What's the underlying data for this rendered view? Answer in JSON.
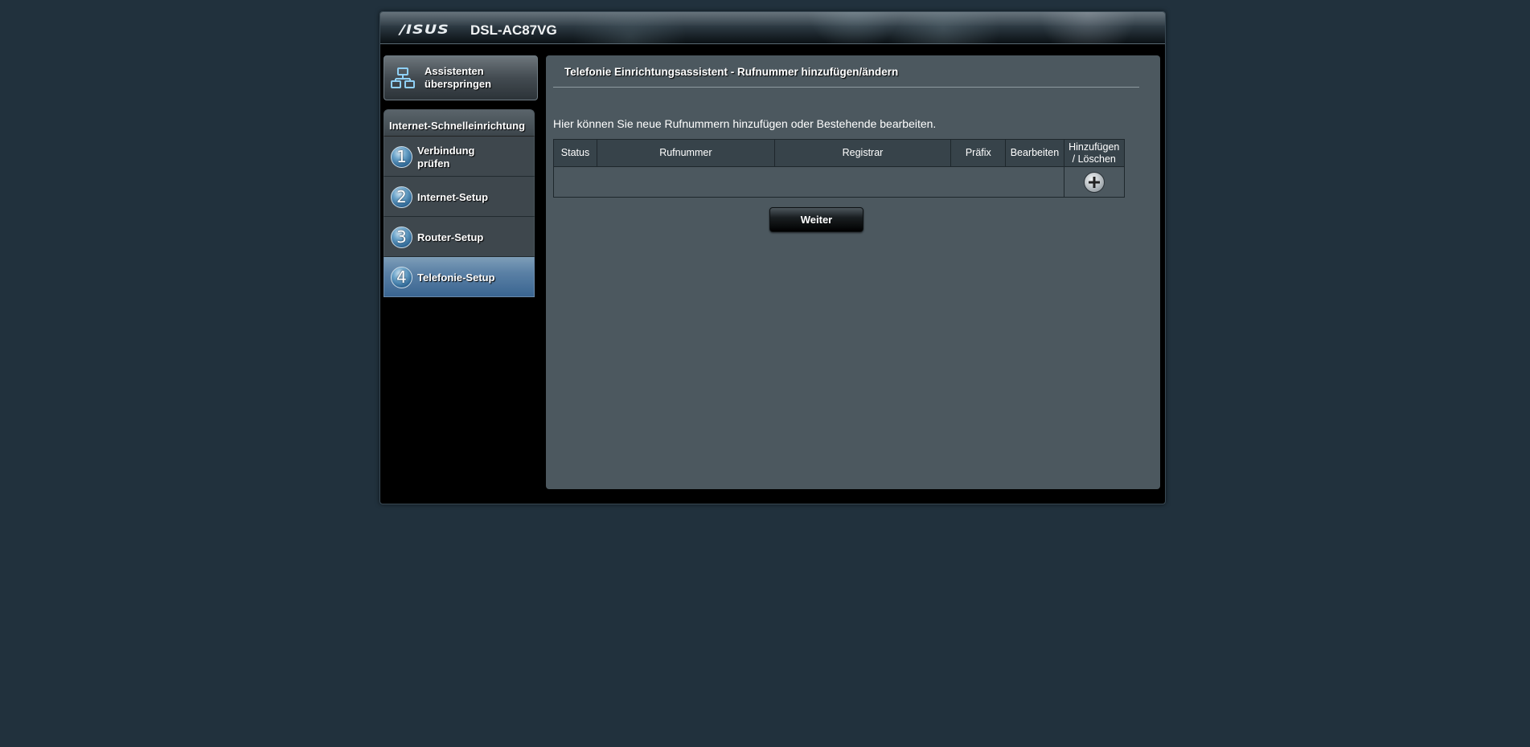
{
  "banner": {
    "brand": "/ISUS",
    "model": "DSL-AC87VG"
  },
  "skip_wizard": {
    "label": "Assistenten überspringen",
    "icon": "network-icon"
  },
  "side_menu": {
    "header": "Internet-Schnelleinrichtung",
    "items": [
      {
        "number": "1",
        "label": "Verbindung prüfen",
        "active": false
      },
      {
        "number": "2",
        "label": "Internet-Setup",
        "active": false
      },
      {
        "number": "3",
        "label": "Router-Setup",
        "active": false
      },
      {
        "number": "4",
        "label": "Telefonie-Setup",
        "active": true
      }
    ]
  },
  "content": {
    "title": "Telefonie Einrichtungsassistent - Rufnummer hinzufügen/ändern",
    "description": "Hier können Sie neue Rufnummern hinzufügen oder Bestehende bearbeiten.",
    "table": {
      "headers": {
        "status": "Status",
        "number": "Rufnummer",
        "registrar": "Registrar",
        "prefix": "Präfix",
        "edit": "Bearbeiten",
        "add_delete_line1": "Hinzufügen",
        "add_delete_line2": "/ Löschen"
      },
      "rows": []
    },
    "next_button": "Weiter"
  },
  "colors": {
    "page_background": "#21313d",
    "panel_background": "#4c585f",
    "active_menu": "#3a6591"
  }
}
